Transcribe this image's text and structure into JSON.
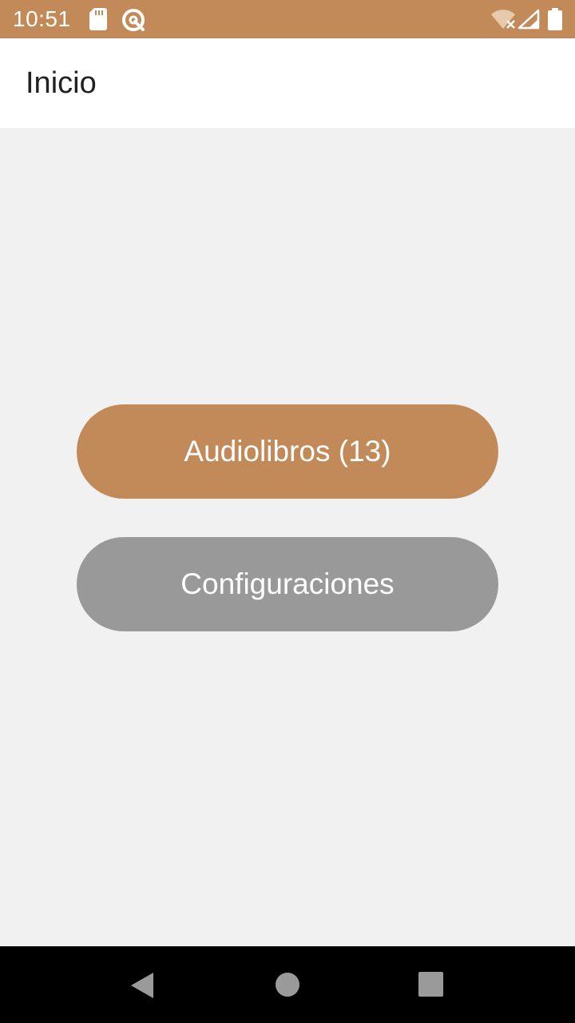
{
  "status_bar": {
    "time": "10:51",
    "icons": [
      "sd-card-icon",
      "qr-circle-icon",
      "wifi-off-icon",
      "signal-icon",
      "battery-icon"
    ],
    "background_color": "#c28a59"
  },
  "app_bar": {
    "title": "Inicio"
  },
  "main": {
    "buttons": [
      {
        "label": "Audiolibros (13)",
        "color": "#c28a59"
      },
      {
        "label": "Configuraciones",
        "color": "#999999"
      }
    ]
  },
  "nav_bar": {
    "icons": [
      "back-icon",
      "home-icon",
      "recents-icon"
    ]
  }
}
